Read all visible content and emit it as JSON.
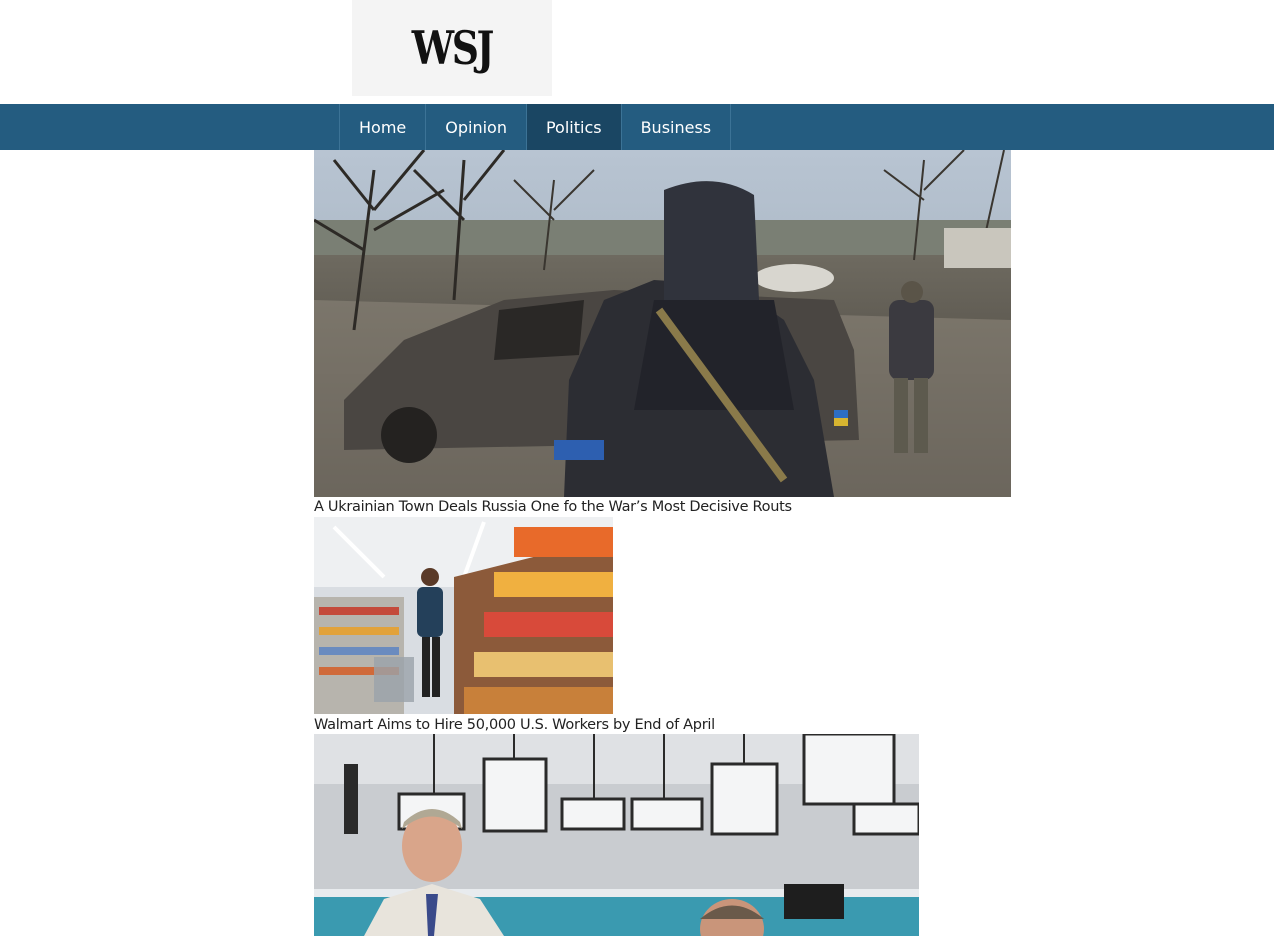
{
  "header": {
    "logo_text": "WSJ"
  },
  "nav": {
    "items": [
      {
        "label": "Home",
        "active": false
      },
      {
        "label": "Opinion",
        "active": false
      },
      {
        "label": "Politics",
        "active": true
      },
      {
        "label": "Business",
        "active": false
      }
    ]
  },
  "articles": [
    {
      "title": "A Ukrainian Town Deals Russia One fo the War’s Most Decisive Routs"
    },
    {
      "title": "Walmart Aims to Hire 50,000 U.S. Workers by End of April"
    },
    {
      "title": ""
    }
  ],
  "colors": {
    "navbar": "#245c80",
    "nav_active": "#1a4663",
    "logo_bg": "#f4f4f4"
  }
}
